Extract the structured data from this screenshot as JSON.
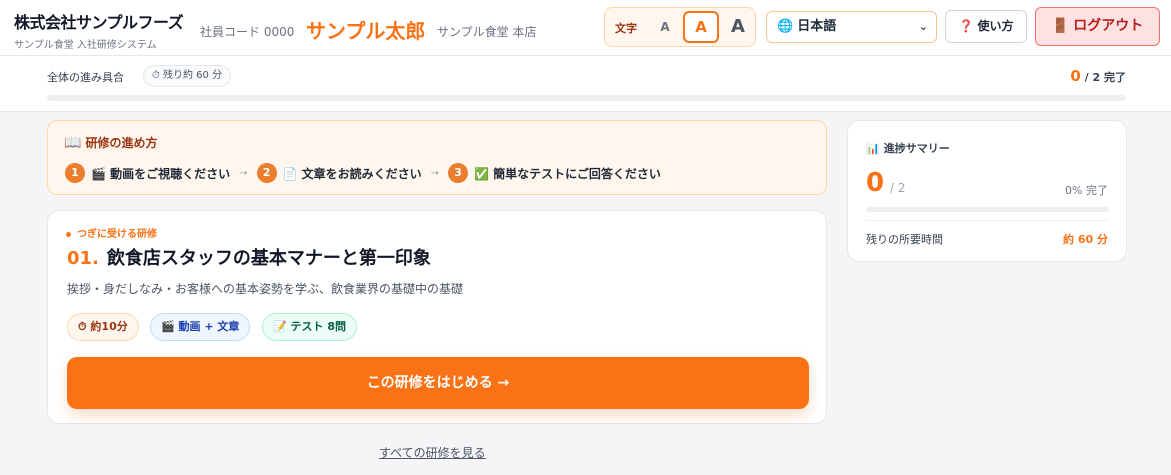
{
  "header": {
    "company": "株式会社サンプルフーズ",
    "system": "サンプル食堂 入社研修システム",
    "employee_code": "社員コード 0000",
    "user_name": "サンプル太郎",
    "store": "サンプル食堂 本店",
    "font_size": {
      "label": "文字",
      "small": "A",
      "medium": "A",
      "large": "A",
      "selected": "medium"
    },
    "language": {
      "icon": "globe-icon",
      "glyph": "🌐",
      "value": "日本語"
    },
    "help": {
      "icon": "question-icon",
      "glyph": "❓",
      "label": "使い方"
    },
    "logout": {
      "icon": "door-icon",
      "glyph": "🚪",
      "label": "ログアウト"
    }
  },
  "progress": {
    "label": "全体の進み具合",
    "remaining_icon": "⏱",
    "remaining": "残り約 60 分",
    "completed": "0",
    "total_text": "/ 2 完了",
    "fraction": 0.0
  },
  "steps": {
    "icon": "📖",
    "title": "研修の進め方",
    "items": [
      {
        "num": "1",
        "text": "🎬 動画をご視聴ください"
      },
      {
        "num": "2",
        "text": "📄 文章をお読みください"
      },
      {
        "num": "3",
        "text": "✅ 簡単なテストにご回答ください"
      }
    ],
    "arrow": "→"
  },
  "course": {
    "next_label": "つぎに受ける研修",
    "number": "01.",
    "title": "飲食店スタッフの基本マナーと第一印象",
    "description": "挨拶・身だしなみ・お客様への基本姿勢を学ぶ、飲食業界の基礎中の基礎",
    "tags": {
      "time": "⏱ 約10分",
      "media": "🎬 動画 + 文章",
      "test": "📝 テスト 8問"
    },
    "start_button": "この研修をはじめる →"
  },
  "all_link": "すべての研修を見る",
  "summary": {
    "icon": "📊",
    "title": "進捗サマリー",
    "completed": "0",
    "total": "/ 2",
    "percent": "0% 完了",
    "fraction": 0.0,
    "time_label": "残りの所要時間",
    "time_value": "約 60 分"
  },
  "colors": {
    "accent": "#f97316",
    "danger": "#b91c1c",
    "background": "#f5f5f7"
  }
}
